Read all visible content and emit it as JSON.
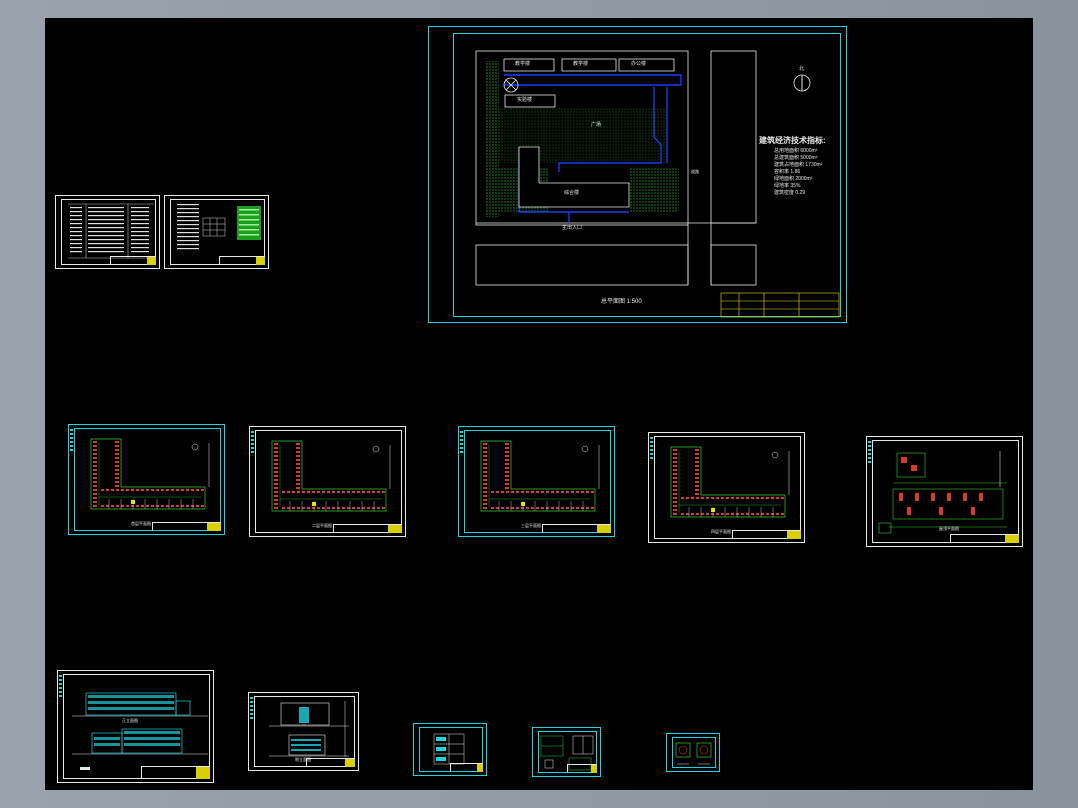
{
  "site_plan": {
    "north_label": "北",
    "indicators_title": "建筑经济技术指标:",
    "indicators": [
      {
        "label": "总用地面积",
        "value": "6000m²"
      },
      {
        "label": "总建筑面积",
        "value": "5000m²"
      },
      {
        "label": "建筑占地面积",
        "value": "1730m²"
      },
      {
        "label": "容积率",
        "value": "1.86"
      },
      {
        "label": "绿地面积",
        "value": "2000m²"
      },
      {
        "label": "绿地率",
        "value": "35%"
      },
      {
        "label": "建筑密度",
        "value": "0.29"
      }
    ],
    "buildings": [
      "教学楼",
      "教学楼",
      "办公楼",
      "实验楼"
    ],
    "court_label": "广场",
    "main_building_label": "综合楼",
    "gate_label": "主出入口",
    "road_label": "道路",
    "caption": "总平面图 1:500"
  },
  "plan_captions": [
    "首层平面图",
    "二层平面图",
    "三层平面图",
    "四层平面图",
    "屋顶平面图"
  ],
  "elevation_captions": [
    "正立面图",
    "侧立面图"
  ],
  "colors": {
    "canvas": "#000000",
    "frame_cyan": "#1fd3e0",
    "frame_white": "#e8e8e8",
    "wall_red": "#d63a2a",
    "plan_green": "#2ed02e",
    "road_blue": "#1a3cf0",
    "tag_yellow": "#e8e300"
  }
}
